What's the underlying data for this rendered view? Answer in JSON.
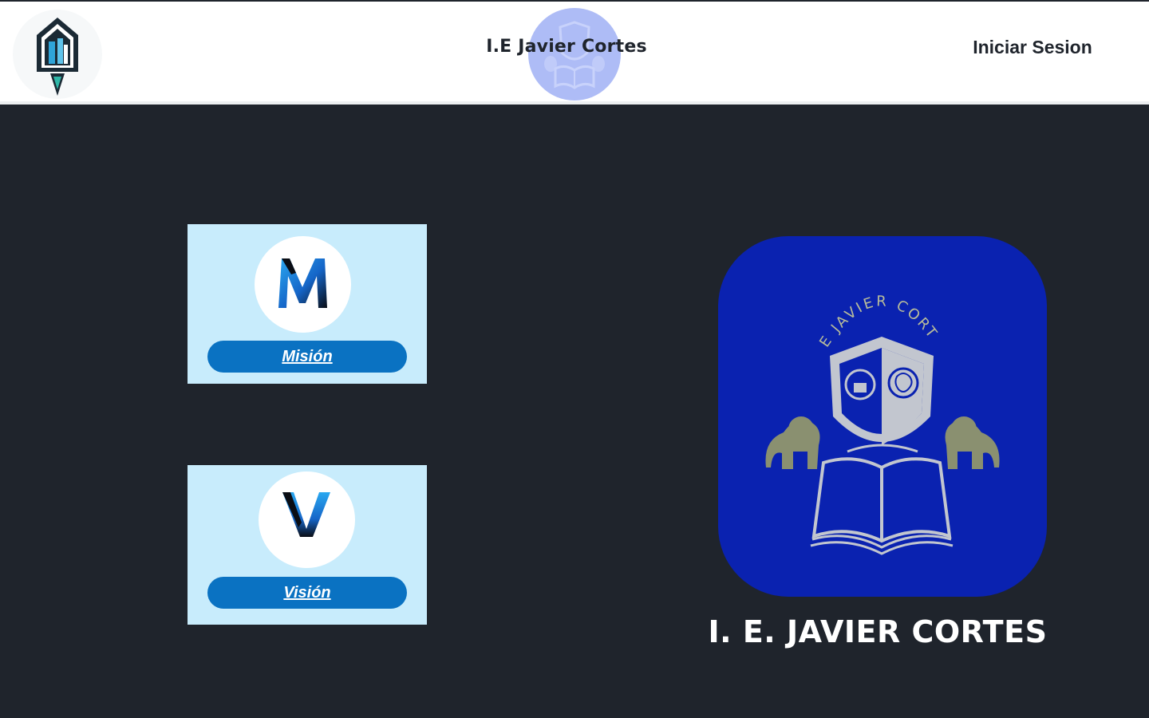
{
  "header": {
    "site_title": "I.E Javier Cortes",
    "login_label": "Iniciar Sesion",
    "logo_icon": "school-building-logo",
    "badge_icon": "school-crest-faded"
  },
  "cards": {
    "mision": {
      "label": "Misión",
      "icon": "letter-m-icon"
    },
    "vision": {
      "label": "Visión",
      "icon": "letter-v-icon"
    }
  },
  "emblem": {
    "crest_text": "I.E JAVIER CORTES",
    "icon": "school-crest-emblem"
  },
  "school_name": "I. E. JAVIER CORTES",
  "colors": {
    "page_bg": "#1f242c",
    "header_bg": "#ffffff",
    "card_bg": "#c8ecfc",
    "button_bg": "#0a72c2",
    "emblem_bg": "#0a22b0",
    "crest_gray": "#c2c6cf",
    "lion_olive": "#8a9070"
  }
}
